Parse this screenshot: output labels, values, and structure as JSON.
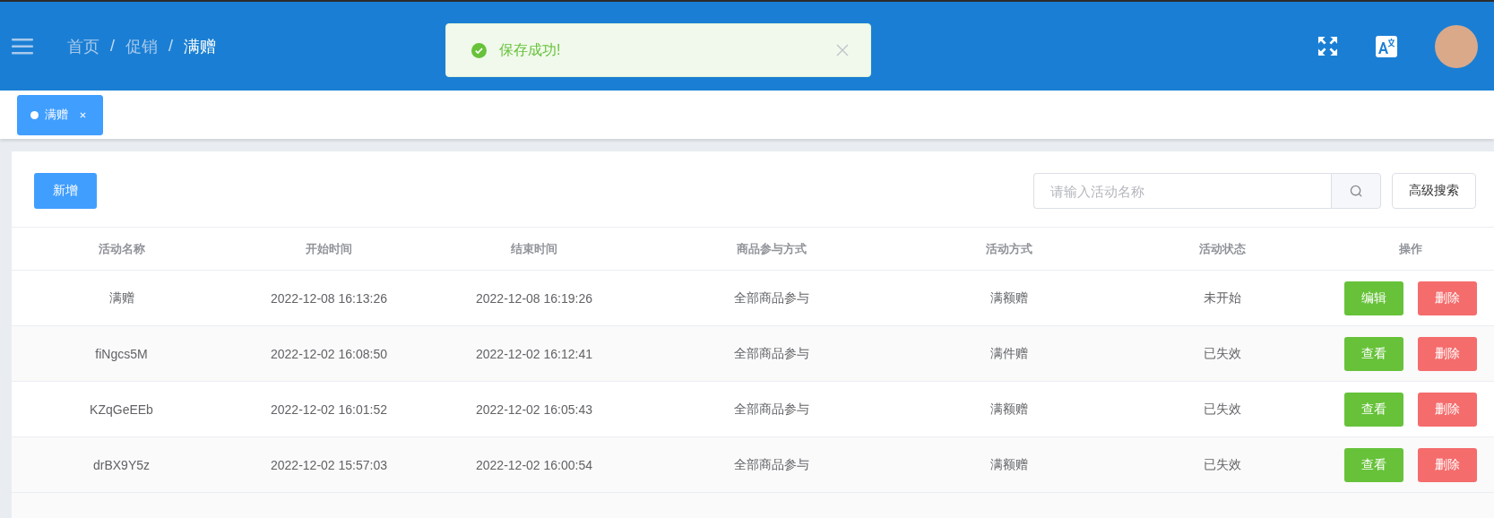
{
  "header": {
    "breadcrumb": [
      {
        "label": "首页",
        "current": false
      },
      {
        "label": "促销",
        "current": false
      },
      {
        "label": "满赠",
        "current": true
      }
    ],
    "separator": "/"
  },
  "toast": {
    "kind": "success",
    "message": "保存成功!"
  },
  "tabs": [
    {
      "label": "满赠",
      "selected": true
    }
  ],
  "toolbar": {
    "add_button": "新增",
    "search": {
      "placeholder": "请输入活动名称"
    },
    "advanced_button": "高级搜索"
  },
  "table": {
    "columns": [
      "活动名称",
      "开始时间",
      "结束时间",
      "商品参与方式",
      "活动方式",
      "活动状态",
      "操作"
    ],
    "rows": [
      {
        "cells": [
          "满赠",
          "2022-12-08 16:13:26",
          "2022-12-08 16:19:26",
          "全部商品参与",
          "满额赠",
          "未开始"
        ],
        "actions": [
          "编辑",
          "删除"
        ]
      },
      {
        "cells": [
          "fiNgcs5M",
          "2022-12-02 16:08:50",
          "2022-12-02 16:12:41",
          "全部商品参与",
          "满件赠",
          "已失效"
        ],
        "actions": [
          "查看",
          "删除"
        ]
      },
      {
        "cells": [
          "KZqGeEEb",
          "2022-12-02 16:01:52",
          "2022-12-02 16:05:43",
          "全部商品参与",
          "满额赠",
          "已失效"
        ],
        "actions": [
          "查看",
          "删除"
        ]
      },
      {
        "cells": [
          "drBX9Y5z",
          "2022-12-02 15:57:03",
          "2022-12-02 16:00:54",
          "全部商品参与",
          "满额赠",
          "已失效"
        ],
        "actions": [
          "查看",
          "删除"
        ]
      }
    ]
  }
}
